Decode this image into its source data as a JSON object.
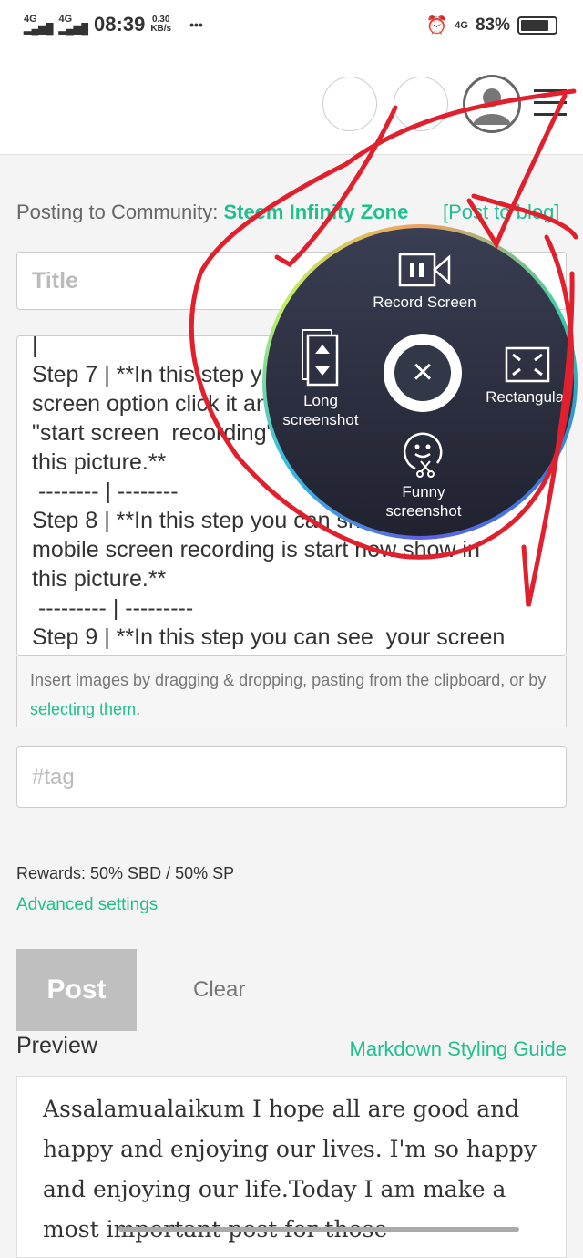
{
  "status": {
    "network1": "4G",
    "network2": "4G",
    "time": "08:39",
    "speed": "0.30",
    "speed_unit": "KB/s",
    "more": "•••",
    "net_right": "4G",
    "battery": "83%",
    "battery_level": 0.83
  },
  "form": {
    "posting_label": "Posting to Community:",
    "community": "Steem Infinity Zone",
    "post_to_blog": "[Post to blog]",
    "title_placeholder": "Title",
    "body": "|\nStep 7 | **In this step you can click the record\nscreen option click it and show a last option is\n\"start screen  recording\"option click show in\nthis picture.**\n -------- | --------\nStep 8 | **In this step you can show a your\nmobile screen recording is start now show in\nthis picture.**\n --------- | ---------\nStep 9 | **In this step you can see  your screen",
    "hint": "Insert images by dragging & dropping, pasting from the clipboard, or by ",
    "hint_link": "selecting them",
    "hint_end": ".",
    "tag_placeholder": "#tag",
    "rewards": "Rewards: 50% SBD / 50% SP",
    "advanced": "Advanced settings",
    "post": "Post",
    "clear": "Clear",
    "preview": "Preview",
    "guide": "Markdown Styling Guide",
    "preview_text": "Assalamualaikum I hope all are good and happy and enjoying our lives. I'm so happy and enjoying our life.Today I am make a most important post for those"
  },
  "menu": {
    "record": "Record Screen",
    "long1": "Long",
    "long2": "screenshot",
    "rect": "Rectangular",
    "funny1": "Funny",
    "funny2": "screenshot",
    "close": "×"
  },
  "colors": {
    "accent": "#1fbf8f",
    "scribble": "#e0202c"
  }
}
